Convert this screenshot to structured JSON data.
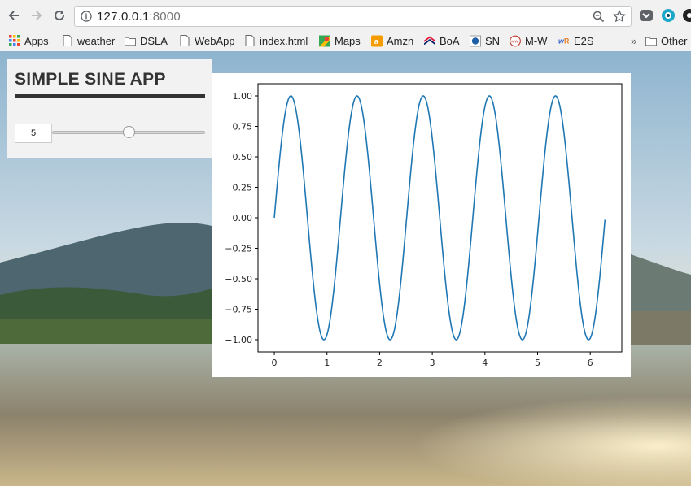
{
  "browser": {
    "url_host": "127.0.0.1",
    "url_port": ":8000",
    "bookmarks": [
      {
        "label": "Apps",
        "icon": "apps-grid-icon"
      },
      {
        "label": "weather",
        "icon": "page-icon"
      },
      {
        "label": "DSLA",
        "icon": "folder-icon"
      },
      {
        "label": "WebApp",
        "icon": "page-icon"
      },
      {
        "label": "index.html",
        "icon": "page-icon"
      },
      {
        "label": "Maps",
        "icon": "maps-icon"
      },
      {
        "label": "Amzn",
        "icon": "amazon-icon"
      },
      {
        "label": "BoA",
        "icon": "boa-icon"
      },
      {
        "label": "SN",
        "icon": "sn-icon"
      },
      {
        "label": "M-W",
        "icon": "mw-icon"
      },
      {
        "label": "E2S",
        "icon": "wr-icon"
      }
    ],
    "overflow_label": "»",
    "other_bookmarks": "Other"
  },
  "app": {
    "title": "SIMPLE SINE APP",
    "input_value": "5",
    "slider_value": 5
  },
  "chart_data": {
    "type": "line",
    "function": "sin(5x)",
    "x_range": [
      0,
      6.28
    ],
    "xlim": [
      -0.31,
      6.6
    ],
    "ylim": [
      -1.1,
      1.1
    ],
    "x_ticks": [
      "0",
      "1",
      "2",
      "3",
      "4",
      "5",
      "6"
    ],
    "y_ticks": [
      "1.00",
      "0.75",
      "0.50",
      "0.25",
      "0.00",
      "−0.25",
      "−0.50",
      "−0.75",
      "−1.00"
    ],
    "line_color": "#1f77b4",
    "grid": false
  }
}
